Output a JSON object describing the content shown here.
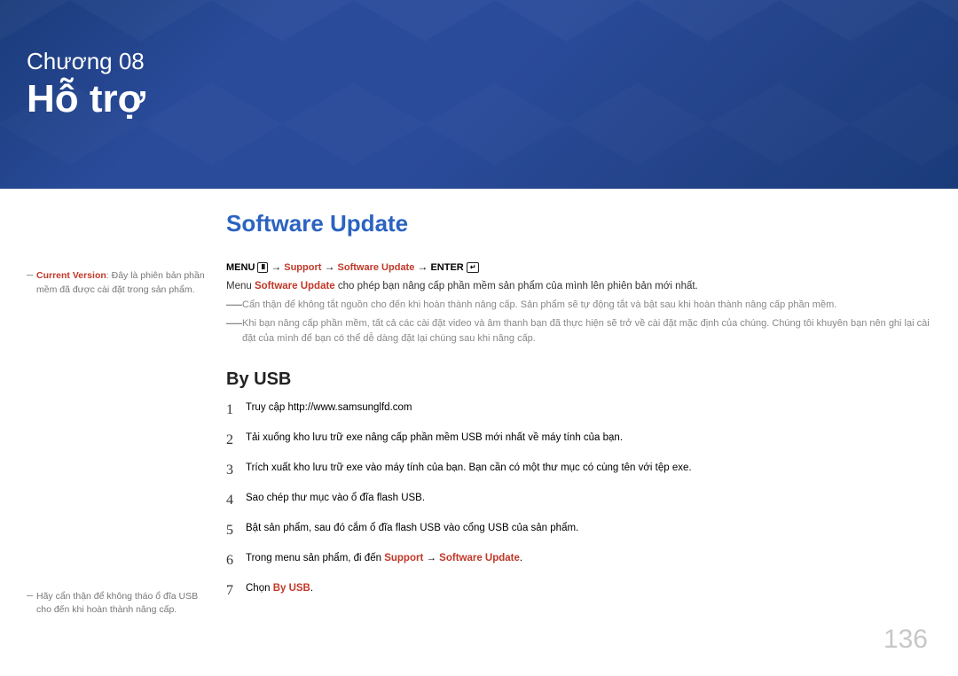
{
  "banner": {
    "chapter_label": "Chương 08",
    "chapter_title": "Hỗ trợ"
  },
  "sidebar": {
    "note1_prefix": "Current Version",
    "note1_rest": ": Đây là phiên bản phần mềm đã được cài đặt trong sản phẩm.",
    "note2": "Hãy cẩn thận để không tháo ổ đĩa USB cho đến khi hoàn thành nâng cấp."
  },
  "main": {
    "title": "Software Update",
    "menupath": {
      "menu": "MENU",
      "menu_icon": "III",
      "arrow": "→",
      "support": "Support",
      "software_update": "Software Update",
      "enter": "ENTER",
      "enter_icon": "↵"
    },
    "intro_part1": "Menu ",
    "intro_hl": "Software Update",
    "intro_part2": " cho phép bạn nâng cấp phần mềm sản phẩm của mình lên phiên bản mới nhất.",
    "note1": "Cẩn thận để không tắt nguồn cho đến khi hoàn thành nâng cấp. Sản phẩm sẽ tự động tắt và bật sau khi hoàn thành nâng cấp phần mềm.",
    "note2": "Khi bạn nâng cấp phần mềm, tất cả các cài đặt video và âm thanh bạn đã thực hiện sẽ trở về cài đặt mặc định của chúng. Chúng tôi khuyên bạn nên ghi lại cài đặt của mình để bạn có thể dễ dàng đặt lại chúng sau khi nâng cấp.",
    "subheading": "By USB",
    "steps": [
      "Truy cập http://www.samsunglfd.com",
      "Tải xuống kho lưu trữ exe nâng cấp phần mềm USB mới nhất về máy tính của bạn.",
      "Trích xuất kho lưu trữ exe vào máy tính của bạn. Bạn cần có một thư mục có cùng tên với tệp exe.",
      "Sao chép thư mục vào ổ đĩa flash USB.",
      "Bật sản phẩm, sau đó cắm ổ đĩa flash USB vào cổng USB của sản phẩm."
    ],
    "step6_prefix": "Trong menu sản phẩm, đi đến ",
    "step6_support": "Support",
    "step6_arrow": " → ",
    "step6_sw": "Software Update",
    "step6_suffix": ".",
    "step7_prefix": "Chọn ",
    "step7_hl": "By USB",
    "step7_suffix": "."
  },
  "page_number": "136"
}
